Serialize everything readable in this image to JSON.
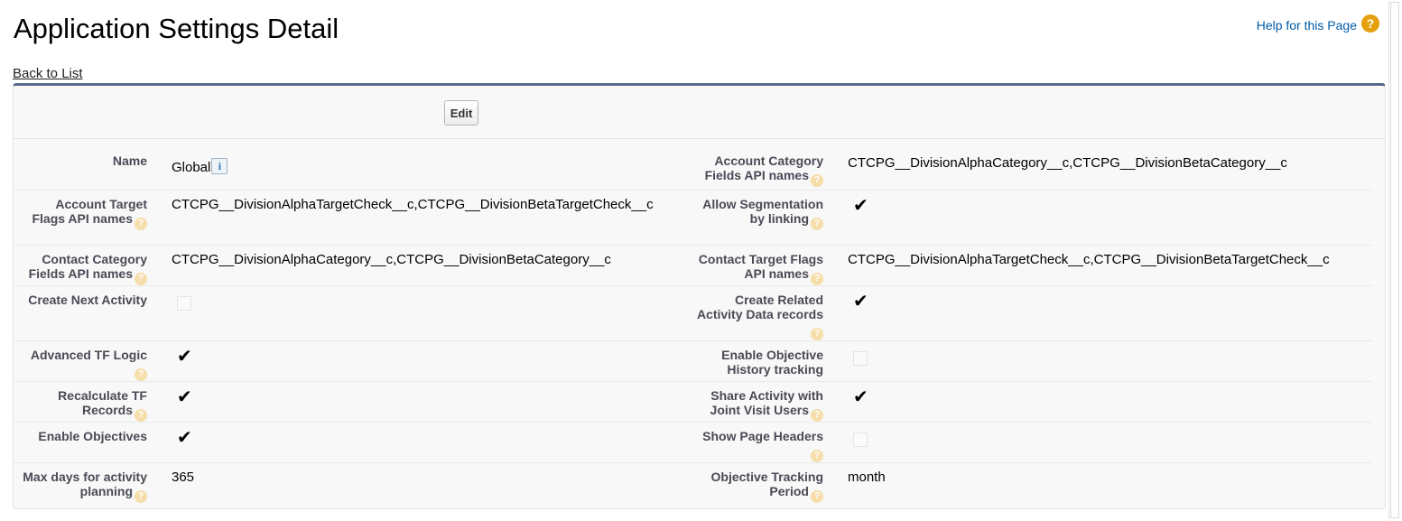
{
  "page": {
    "title": "Application Settings Detail",
    "help_link": "Help for this Page",
    "help_icon": "?",
    "back_link": "Back to List"
  },
  "toolbar": {
    "edit_label": "Edit"
  },
  "hint_icon_glyph": "?",
  "info_icon_glyph": "i",
  "check_glyph": "✔",
  "fields": {
    "name": {
      "label": "Name",
      "value": "Global"
    },
    "account_category": {
      "label": "Account Category Fields API names",
      "value": "CTCPG__DivisionAlphaCategory__c,CTCPG__DivisionBetaCategory__c"
    },
    "account_target": {
      "label": "Account Target Flags API names",
      "value": "CTCPG__DivisionAlphaTargetCheck__c,CTCPG__DivisionBetaTargetCheck__c"
    },
    "allow_segmentation": {
      "label": "Allow Segmentation by linking",
      "checked": true
    },
    "contact_category": {
      "label": "Contact Category Fields API names",
      "value": "CTCPG__DivisionAlphaCategory__c,CTCPG__DivisionBetaCategory__c"
    },
    "contact_target": {
      "label": "Contact Target Flags API names",
      "value": "CTCPG__DivisionAlphaTargetCheck__c,CTCPG__DivisionBetaTargetCheck__c"
    },
    "create_next_activity": {
      "label": "Create Next Activity",
      "checked": false
    },
    "create_related_activity": {
      "label": "Create Related Activity Data records",
      "checked": true
    },
    "advanced_tf_logic": {
      "label": "Advanced TF Logic",
      "checked": true
    },
    "enable_objective_history": {
      "label": "Enable Objective History tracking",
      "checked": false
    },
    "recalculate_tf": {
      "label": "Recalculate TF Records",
      "checked": true
    },
    "share_activity": {
      "label": "Share Activity with Joint Visit Users",
      "checked": true
    },
    "enable_objectives": {
      "label": "Enable Objectives",
      "checked": true
    },
    "show_page_headers": {
      "label": "Show Page Headers",
      "checked": false
    },
    "max_days": {
      "label": "Max days for activity planning",
      "value": "365"
    },
    "objective_tracking": {
      "label": "Objective Tracking Period",
      "value": "month"
    }
  }
}
